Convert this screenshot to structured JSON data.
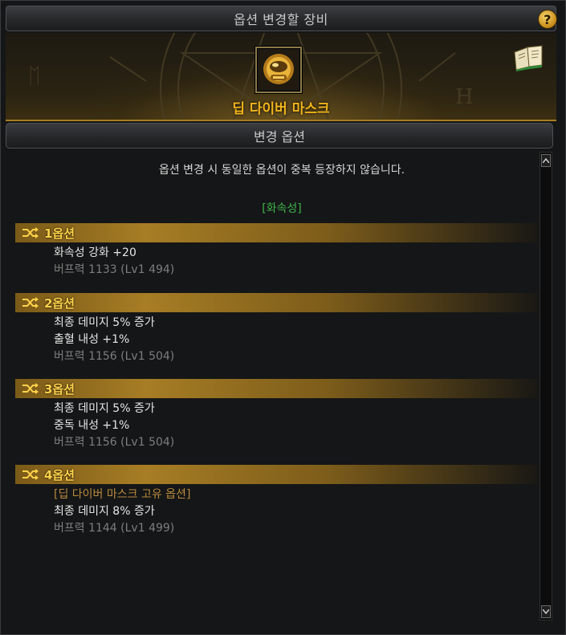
{
  "window": {
    "title": "옵션 변경할 장비",
    "help_label": "?"
  },
  "item": {
    "name": "딥 다이버 마스크",
    "icon": "diver-mask-icon"
  },
  "section": {
    "title": "변경 옵션"
  },
  "notice": "옵션 변경 시 동일한 옵션이 중복 등장하지 않습니다.",
  "attribute_tag": "[화속성]",
  "options": [
    {
      "label": "1옵션",
      "lines": [
        "화속성 강화 +20"
      ],
      "buff": "버프력 1133 (Lv1 494)"
    },
    {
      "label": "2옵션",
      "lines": [
        "최종 데미지 5% 증가",
        "출혈 내성 +1%"
      ],
      "buff": "버프력 1156 (Lv1 504)"
    },
    {
      "label": "3옵션",
      "lines": [
        "최종 데미지 5% 증가",
        "중독 내성 +1%"
      ],
      "buff": "버프력 1156 (Lv1 504)"
    },
    {
      "label": "4옵션",
      "unique": "[딥 다이버 마스크 고유 옵션]",
      "lines": [
        "최종 데미지 8% 증가"
      ],
      "buff": "버프력 1144 (Lv1 499)"
    }
  ],
  "colors": {
    "item_name": "#f0b41c",
    "option_header": "#ffd24a",
    "attribute": "#3fb44a",
    "buff_text": "#7d7d7d"
  }
}
